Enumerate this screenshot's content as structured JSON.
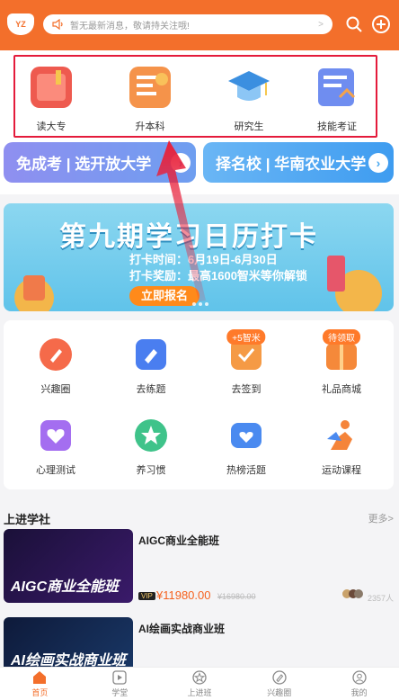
{
  "header": {
    "logo_text": "YZ",
    "notice_text": "暂无最新消息，敬请持关注哦!",
    "notice_arrow": ">",
    "search_icon": "search-icon",
    "add_icon": "add-icon"
  },
  "categories": [
    {
      "label": "读大专",
      "icon": "book-icon",
      "color": "#ee5a4f"
    },
    {
      "label": "升本科",
      "icon": "document-icon",
      "color": "#f5934a"
    },
    {
      "label": "研究生",
      "icon": "graduation-cap-icon",
      "color": "#4aa3e8"
    },
    {
      "label": "技能考证",
      "icon": "certificate-icon",
      "color": "#6f8df0"
    }
  ],
  "banners": [
    {
      "label": "免成考 | 选开放大学",
      "color": "#7a86e8"
    },
    {
      "label": "择名校 | 华南农业大学",
      "color": "#4aa8f0"
    }
  ],
  "promo": {
    "title": "第九期学习日历打卡",
    "line1": "打卡时间：6月19日-6月30日",
    "line2": "打卡奖励：最高1600智米等你解锁",
    "cta": "立即报名"
  },
  "grid": [
    {
      "label": "兴趣圈",
      "icon": "pen-icon",
      "color": "#f56a4a",
      "tag": ""
    },
    {
      "label": "去练题",
      "icon": "edit-icon",
      "color": "#4a7ef0",
      "tag": ""
    },
    {
      "label": "去签到",
      "icon": "check-icon",
      "color": "#f59a45",
      "tag": "+5智米"
    },
    {
      "label": "礼品商城",
      "icon": "gift-icon",
      "color": "#f5893a",
      "tag": "待领取"
    },
    {
      "label": "心理测试",
      "icon": "heart-icon",
      "color": "#a46ef0",
      "tag": ""
    },
    {
      "label": "养习惯",
      "icon": "star-icon",
      "color": "#3fc38a",
      "tag": ""
    },
    {
      "label": "热榜活题",
      "icon": "heart-card-icon",
      "color": "#4a8af0",
      "tag": ""
    },
    {
      "label": "运动课程",
      "icon": "runner-icon",
      "color": "#f5843a",
      "tag": ""
    }
  ],
  "section": {
    "title": "上进学社",
    "more": "更多>"
  },
  "courses": [
    {
      "name": "AIGC商业全能班",
      "thumb_text": "AIGC商业全能班",
      "vip": "VIP",
      "price": "¥11980.00",
      "original": "¥16980.00",
      "count": "2357人"
    },
    {
      "name": "AI绘画实战商业班",
      "thumb_text": "AI绘画实战商业班",
      "vip": "",
      "price": "",
      "original": "",
      "count": ""
    }
  ],
  "tabbar": [
    {
      "label": "首页",
      "icon": "home-icon",
      "active": true
    },
    {
      "label": "学堂",
      "icon": "play-icon",
      "active": false
    },
    {
      "label": "上进班",
      "icon": "star-badge-icon",
      "active": false
    },
    {
      "label": "兴趣圈",
      "icon": "pencil-icon",
      "active": false
    },
    {
      "label": "我的",
      "icon": "user-icon",
      "active": false
    }
  ],
  "colors": {
    "accent": "#f36f2b",
    "highlight_box": "#e41b3b",
    "price": "#f5621f"
  }
}
